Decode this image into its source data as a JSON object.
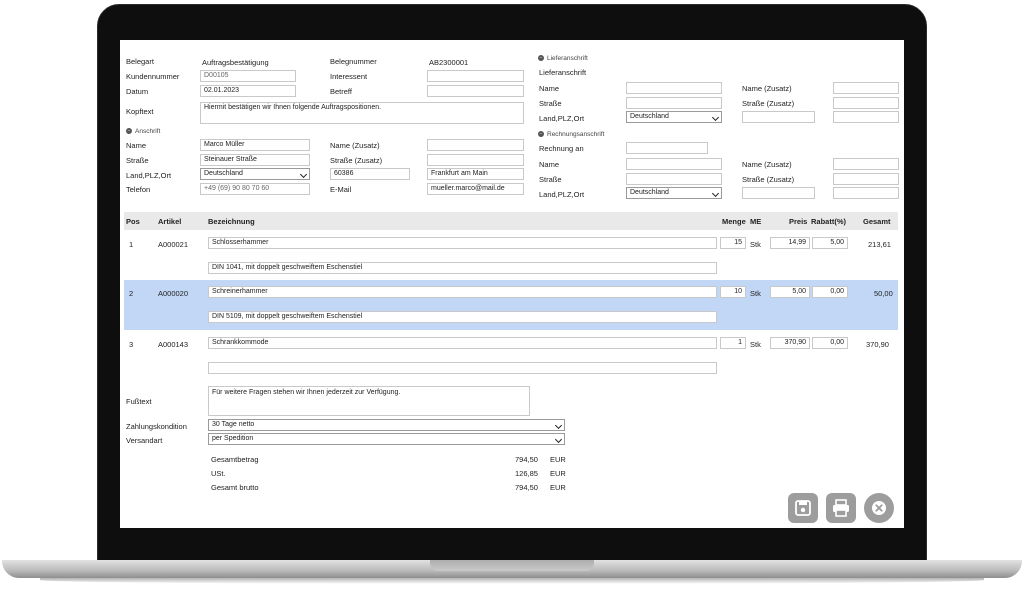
{
  "header": {
    "belegart_label": "Belegart",
    "belegart_value": "Auftragsbestätigung",
    "belegnummer_label": "Belegnummer",
    "belegnummer_value": "AB2300001",
    "kundennummer_label": "Kundennummer",
    "kundennummer_value": "D00105",
    "interessent_label": "Interessent",
    "datum_label": "Datum",
    "datum_value": "02.01.2023",
    "betreff_label": "Betreff",
    "kopftext_label": "Kopftext",
    "kopftext_value": "Hiermit bestätigen wir Ihnen folgende Auftragspositionen."
  },
  "anschrift": {
    "section_label": "Anschrift",
    "name_label": "Name",
    "name_value": "Marco Müller",
    "name_zusatz_label": "Name (Zusatz)",
    "strasse_label": "Straße",
    "strasse_value": "Steinauer Straße",
    "strasse_zusatz_label": "Straße (Zusatz)",
    "land_label": "Land,PLZ,Ort",
    "land_value": "Deutschland",
    "plz_value": "60386",
    "ort_value": "Frankfurt am Main",
    "telefon_label": "Telefon",
    "telefon_value": "+49 (69) 90 80 70 60",
    "email_label": "E-Mail",
    "email_value": "mueller.marco@mail.de"
  },
  "lieferanschrift": {
    "section_label": "Lieferanschrift",
    "title": "Lieferanschrift",
    "name_label": "Name",
    "name_zusatz_label": "Name (Zusatz)",
    "strasse_label": "Straße",
    "strasse_zusatz_label": "Straße (Zusatz)",
    "land_label": "Land,PLZ,Ort",
    "land_value": "Deutschland"
  },
  "rechnungsanschrift": {
    "section_label": "Rechnungsanschrift",
    "rechnung_an_label": "Rechnung an",
    "name_label": "Name",
    "name_zusatz_label": "Name (Zusatz)",
    "strasse_label": "Straße",
    "strasse_zusatz_label": "Straße (Zusatz)",
    "land_label": "Land,PLZ,Ort",
    "land_value": "Deutschland"
  },
  "table": {
    "headers": {
      "pos": "Pos",
      "artikel": "Artikel",
      "bezeichnung": "Bezeichnung",
      "menge": "Menge",
      "me": "ME",
      "preis": "Preis",
      "rabatt": "Rabatt(%)",
      "gesamt": "Gesamt"
    },
    "rows": [
      {
        "pos": "1",
        "artikel": "A000021",
        "bezeichnung": "Schlosserhammer",
        "beschreibung": "DIN 1041, mit doppelt geschweiftem Eschenstiel",
        "menge": "15",
        "me": "Stk",
        "preis": "14,99",
        "rabatt": "5,00",
        "gesamt": "213,61"
      },
      {
        "pos": "2",
        "artikel": "A000020",
        "bezeichnung": "Schreinerhammer",
        "beschreibung": "DIN 5109, mit doppelt geschweiftem Eschenstiel",
        "menge": "10",
        "me": "Stk",
        "preis": "5,00",
        "rabatt": "0,00",
        "gesamt": "50,00"
      },
      {
        "pos": "3",
        "artikel": "A000143",
        "bezeichnung": "Schrankkommode",
        "beschreibung": "",
        "menge": "1",
        "me": "Stk",
        "preis": "370,90",
        "rabatt": "0,00",
        "gesamt": "370,90"
      }
    ]
  },
  "footer": {
    "fusstext_label": "Fußtext",
    "fusstext_value": "Für weitere Fragen stehen wir Ihnen jederzeit zur Verfügung.",
    "zahlung_label": "Zahlungskondition",
    "zahlung_value": "30 Tage netto",
    "versand_label": "Versandart",
    "versand_value": "per Spedition"
  },
  "totals": [
    {
      "label": "Gesamtbetrag",
      "value": "794,50",
      "currency": "EUR"
    },
    {
      "label": "USt.",
      "value": "126,85",
      "currency": "EUR"
    },
    {
      "label": "Gesamt brutto",
      "value": "794,50",
      "currency": "EUR"
    }
  ],
  "actions": {
    "save_icon": "save-icon",
    "print_icon": "print-icon",
    "close_icon": "close-icon"
  },
  "colors": {
    "selected_row": "#c2d7f6",
    "table_header": "#e9e9e9",
    "button": "#9d9d9d"
  }
}
